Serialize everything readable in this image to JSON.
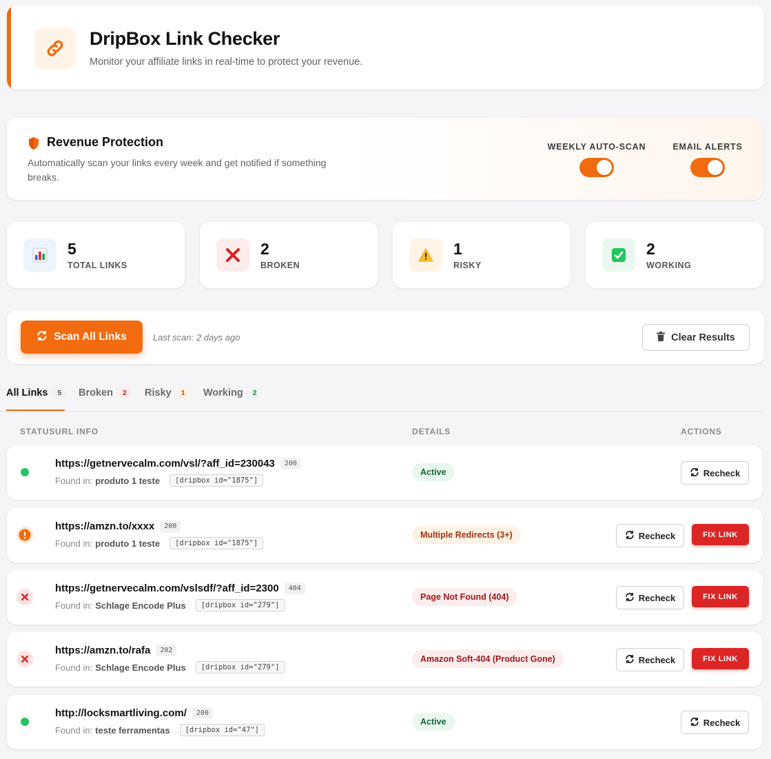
{
  "header": {
    "title": "DripBox Link Checker",
    "subtitle": "Monitor your affiliate links in real-time to protect your revenue.",
    "accent_color": "#f26b0f",
    "icon": "link-icon"
  },
  "revenue": {
    "title": "Revenue Protection",
    "description": "Automatically scan your links every week and get notified if something breaks.",
    "icon": "shield-icon",
    "toggles": [
      {
        "label": "WEEKLY AUTO-SCAN",
        "on": true
      },
      {
        "label": "EMAIL ALERTS",
        "on": true
      }
    ]
  },
  "stats": [
    {
      "value": "5",
      "label": "TOTAL LINKS",
      "icon": "bar-chart-icon"
    },
    {
      "value": "2",
      "label": "BROKEN",
      "icon": "cross-mark-icon"
    },
    {
      "value": "1",
      "label": "RISKY",
      "icon": "warning-icon"
    },
    {
      "value": "2",
      "label": "WORKING",
      "icon": "check-mark-icon"
    }
  ],
  "actions": {
    "scan_label": "Scan All Links",
    "last_scan": "Last scan: 2 days ago",
    "clear_label": "Clear Results"
  },
  "tabs": [
    {
      "label": "All Links",
      "count": "5",
      "active": true
    },
    {
      "label": "Broken",
      "count": "2"
    },
    {
      "label": "Risky",
      "count": "1"
    },
    {
      "label": "Working",
      "count": "2"
    }
  ],
  "table": {
    "col_status_url": "STATUSURL INFO",
    "col_details": "DETAILS",
    "col_actions": "ACTIONS"
  },
  "rows": [
    {
      "status": "ok",
      "url": "https://getnervecalm.com/vsl/?aff_id=230043",
      "code": "200",
      "found_label": "Found in:",
      "source": "produto 1 teste",
      "shortcode": "[dripbox id=\"1875\"]",
      "detail": "Active",
      "recheck": "Recheck"
    },
    {
      "status": "warning",
      "url": "https://amzn.to/xxxx",
      "code": "200",
      "found_label": "Found in:",
      "source": "produto 1 teste",
      "shortcode": "[dripbox id=\"1875\"]",
      "detail": "Multiple Redirects (3+)",
      "recheck": "Recheck",
      "fix": "FIX LINK"
    },
    {
      "status": "broken",
      "url": "https://getnervecalm.com/vslsdf/?aff_id=2300",
      "code": "404",
      "found_label": "Found in:",
      "source": "Schlage Encode Plus",
      "shortcode": "[dripbox id=\"279\"]",
      "detail": "Page Not Found (404)",
      "recheck": "Recheck",
      "fix": "FIX LINK"
    },
    {
      "status": "broken",
      "url": "https://amzn.to/rafa",
      "code": "202",
      "found_label": "Found in:",
      "source": "Schlage Encode Plus",
      "shortcode": "[dripbox id=\"279\"]",
      "detail": "Amazon Soft-404 (Product Gone)",
      "recheck": "Recheck",
      "fix": "FIX LINK"
    },
    {
      "status": "ok",
      "url": "http://locksmartliving.com/",
      "code": "200",
      "found_label": "Found in:",
      "source": "teste ferramentas",
      "shortcode": "[dripbox id=\"47\"]",
      "detail": "Active",
      "recheck": "Recheck"
    }
  ]
}
